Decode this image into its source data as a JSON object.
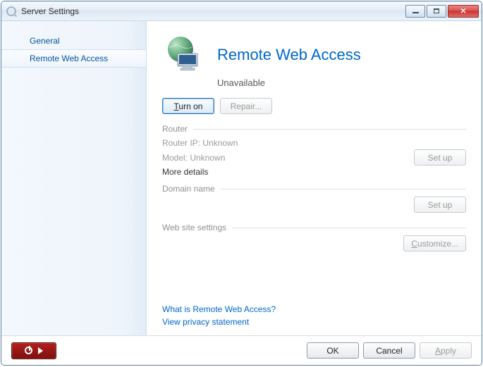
{
  "window": {
    "title": "Server Settings"
  },
  "sidebar": {
    "items": [
      {
        "label": "General"
      },
      {
        "label": "Remote Web Access"
      }
    ],
    "selected": 1
  },
  "header": {
    "title": "Remote Web Access",
    "status": "Unavailable"
  },
  "actions": {
    "turn_on": "Turn on",
    "repair": "Repair..."
  },
  "sections": {
    "router": {
      "title": "Router",
      "ip": "Router IP: Unknown",
      "model": "Model: Unknown",
      "more": "More details",
      "setup": "Set up"
    },
    "domain": {
      "title": "Domain name",
      "setup": "Set up"
    },
    "website": {
      "title": "Web site settings",
      "customize": "Customize..."
    }
  },
  "links": {
    "what": "What is Remote Web Access?",
    "privacy": "View privacy statement"
  },
  "footer": {
    "ok": "OK",
    "cancel": "Cancel",
    "apply": "Apply"
  }
}
